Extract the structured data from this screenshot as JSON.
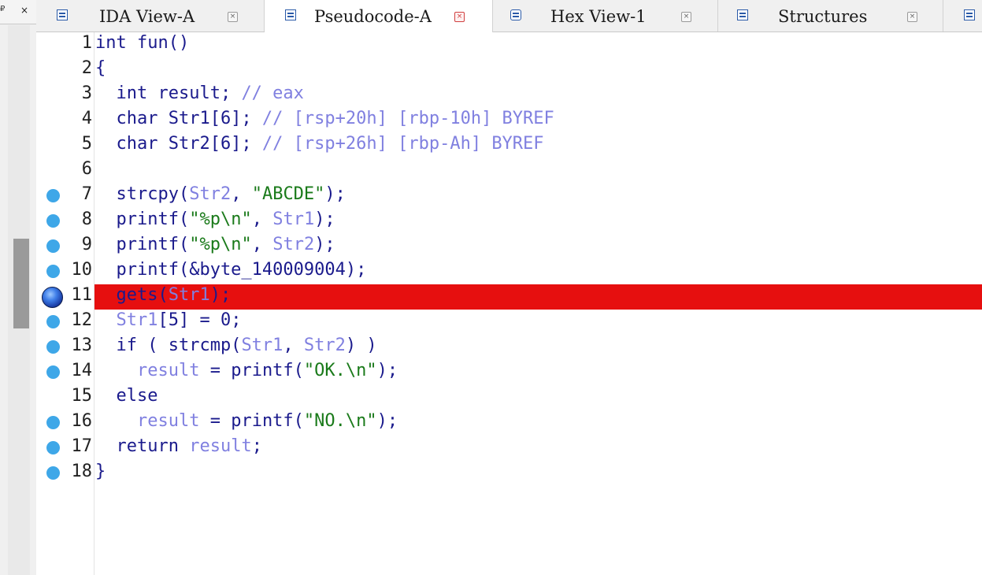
{
  "left_panel": {
    "pin_icon": "pin-icon",
    "close_label": "×"
  },
  "tabs": [
    {
      "label": "IDA View-A",
      "icon": "disassembly-icon",
      "active": false
    },
    {
      "label": "Pseudocode-A",
      "icon": "pseudocode-icon",
      "active": true
    },
    {
      "label": "Hex View-1",
      "icon": "hex-icon",
      "active": false
    },
    {
      "label": "Structures",
      "icon": "structures-icon",
      "active": false
    }
  ],
  "tab_close_label": "×",
  "code": {
    "highlight_color": "#e60f0f",
    "breakpoint_color": "#3ea7e8",
    "lines": [
      {
        "num": "1",
        "parts": [
          [
            "kw",
            "int fun()"
          ]
        ]
      },
      {
        "num": "2",
        "parts": [
          [
            "kw",
            "{"
          ]
        ]
      },
      {
        "num": "3",
        "parts": [
          [
            "kw",
            "  int result; "
          ],
          [
            "cm",
            "// eax"
          ]
        ]
      },
      {
        "num": "4",
        "parts": [
          [
            "kw",
            "  char Str1[6]; "
          ],
          [
            "cm",
            "// [rsp+20h] [rbp-10h] BYREF"
          ]
        ]
      },
      {
        "num": "5",
        "parts": [
          [
            "kw",
            "  char Str2[6]; "
          ],
          [
            "cm",
            "// [rsp+26h] [rbp-Ah] BYREF"
          ]
        ]
      },
      {
        "num": "6",
        "parts": []
      },
      {
        "num": "7",
        "dot": true,
        "parts": [
          [
            "kw",
            "  strcpy("
          ],
          [
            "var",
            "Str2"
          ],
          [
            "kw",
            ", "
          ],
          [
            "str",
            "\"ABCDE\""
          ],
          [
            "kw",
            ");"
          ]
        ]
      },
      {
        "num": "8",
        "dot": true,
        "parts": [
          [
            "kw",
            "  printf("
          ],
          [
            "str",
            "\"%p\\n\""
          ],
          [
            "kw",
            ", "
          ],
          [
            "var",
            "Str1"
          ],
          [
            "kw",
            ");"
          ]
        ]
      },
      {
        "num": "9",
        "dot": true,
        "parts": [
          [
            "kw",
            "  printf("
          ],
          [
            "str",
            "\"%p\\n\""
          ],
          [
            "kw",
            ", "
          ],
          [
            "var",
            "Str2"
          ],
          [
            "kw",
            ");"
          ]
        ]
      },
      {
        "num": "10",
        "dot": true,
        "parts": [
          [
            "kw",
            "  printf(&byte_140009004);"
          ]
        ]
      },
      {
        "num": "11",
        "current": true,
        "parts": [
          [
            "kw",
            "  gets("
          ],
          [
            "var",
            "Str1"
          ],
          [
            "kw",
            ");"
          ]
        ]
      },
      {
        "num": "12",
        "dot": true,
        "parts": [
          [
            "kw",
            "  "
          ],
          [
            "var",
            "Str1"
          ],
          [
            "kw",
            "[5] = 0;"
          ]
        ]
      },
      {
        "num": "13",
        "dot": true,
        "parts": [
          [
            "kw",
            "  if ( strcmp("
          ],
          [
            "var",
            "Str1"
          ],
          [
            "kw",
            ", "
          ],
          [
            "var",
            "Str2"
          ],
          [
            "kw",
            ") )"
          ]
        ]
      },
      {
        "num": "14",
        "dot": true,
        "parts": [
          [
            "kw",
            "    "
          ],
          [
            "var",
            "result"
          ],
          [
            "kw",
            " = printf("
          ],
          [
            "str",
            "\"OK.\\n\""
          ],
          [
            "kw",
            ");"
          ]
        ]
      },
      {
        "num": "15",
        "parts": [
          [
            "kw",
            "  else"
          ]
        ]
      },
      {
        "num": "16",
        "dot": true,
        "parts": [
          [
            "kw",
            "    "
          ],
          [
            "var",
            "result"
          ],
          [
            "kw",
            " = printf("
          ],
          [
            "str",
            "\"NO.\\n\""
          ],
          [
            "kw",
            ");"
          ]
        ]
      },
      {
        "num": "17",
        "dot": true,
        "parts": [
          [
            "kw",
            "  return "
          ],
          [
            "var",
            "result"
          ],
          [
            "kw",
            ";"
          ]
        ]
      },
      {
        "num": "18",
        "dot": true,
        "parts": [
          [
            "kw",
            "}"
          ]
        ]
      }
    ]
  }
}
